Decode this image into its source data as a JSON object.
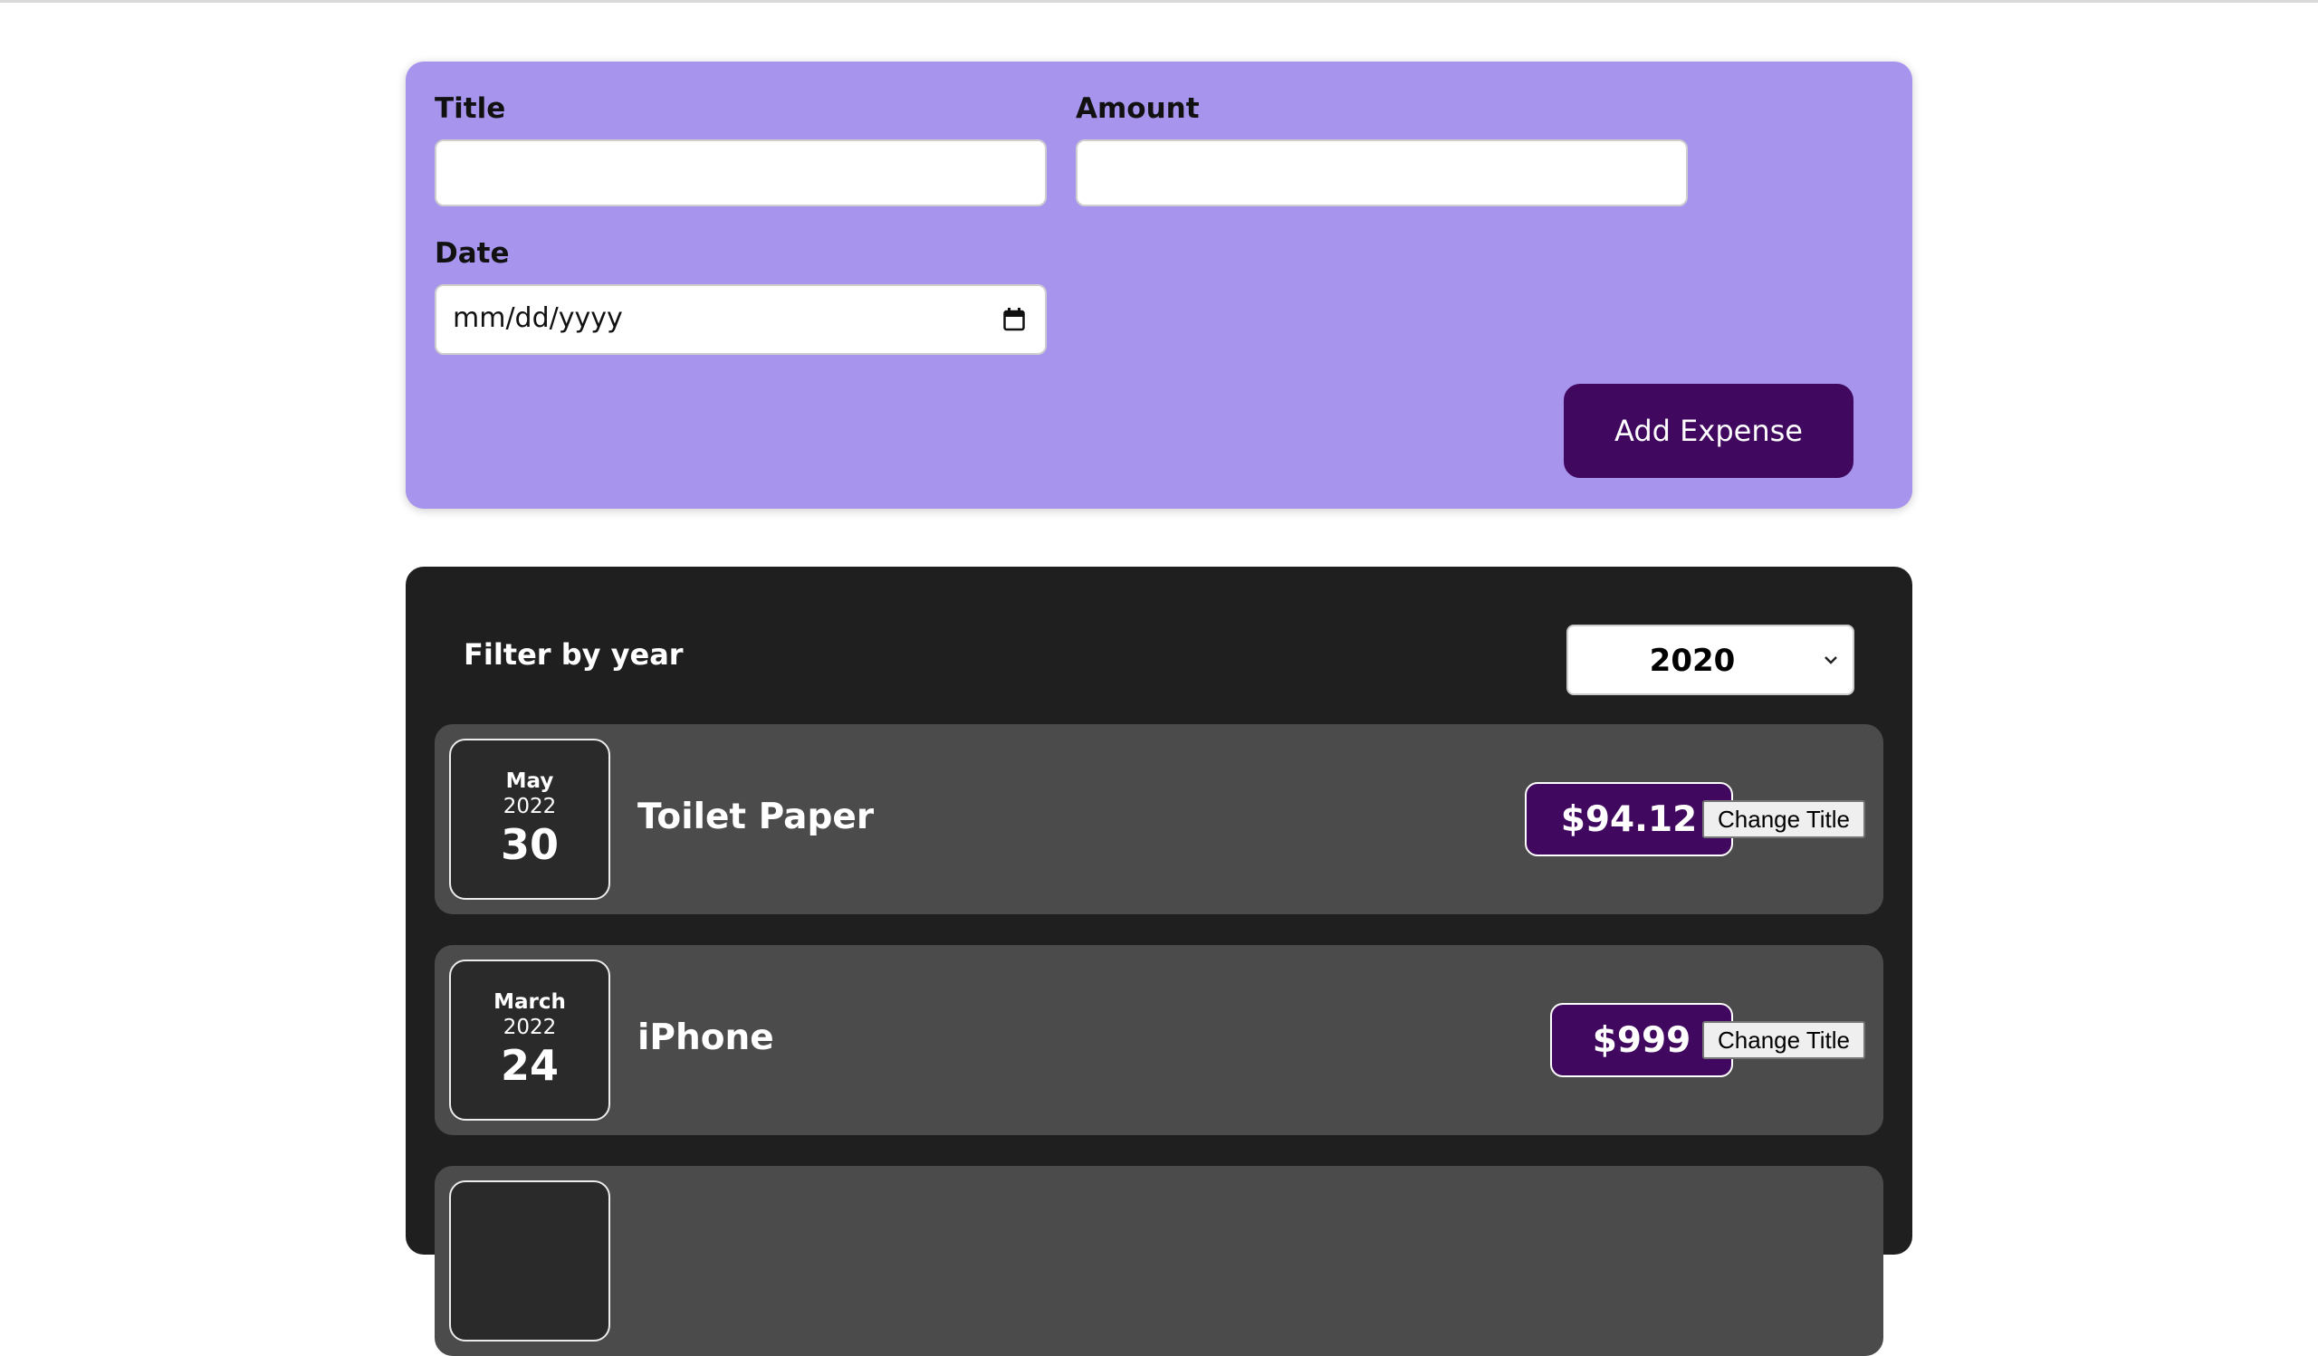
{
  "form": {
    "title_label": "Title",
    "title_value": "",
    "amount_label": "Amount",
    "amount_value": "",
    "date_label": "Date",
    "date_placeholder": "mm/dd/yyyy",
    "submit_label": "Add Expense"
  },
  "filter": {
    "label": "Filter by year",
    "selected_year": "2020"
  },
  "expenses": [
    {
      "month": "May",
      "year": "2022",
      "day": "30",
      "title": "Toilet Paper",
      "amount": "$94.12",
      "action": "Change Title"
    },
    {
      "month": "March",
      "year": "2022",
      "day": "24",
      "title": "iPhone",
      "amount": "$999",
      "action": "Change Title"
    }
  ],
  "colors": {
    "form_bg": "#a794ec",
    "accent": "#40095f",
    "panel_bg": "#1f1f1f",
    "item_bg": "#4b4b4b"
  }
}
